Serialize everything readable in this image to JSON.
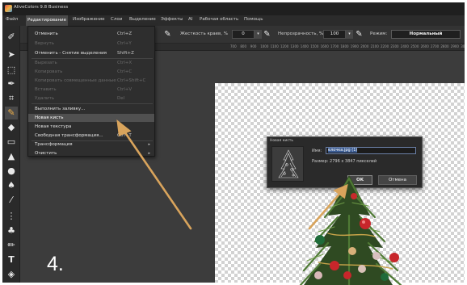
{
  "app": {
    "title": "AliveColors 9.8 Business"
  },
  "menu": {
    "items": [
      "Файл",
      "Редактирование",
      "Изображение",
      "Слои",
      "Выделение",
      "Эффекты",
      "AI",
      "Рабочая область",
      "Помощь"
    ],
    "active_index": 1
  },
  "options": {
    "hardness_label": "Жесткость краев, %",
    "hardness_value": "0",
    "opacity_label": "Непрозрачность, %",
    "opacity_value": "100",
    "mode_label": "Режим:",
    "mode_value": "Нормальный"
  },
  "ruler": {
    "ticks": [
      "700",
      "800",
      "900",
      "1000",
      "1100",
      "1200",
      "1300",
      "1400",
      "1500",
      "1600",
      "1700",
      "1800",
      "1900",
      "2000",
      "2100",
      "2200",
      "2300",
      "2400",
      "2500",
      "2600",
      "2700",
      "2800",
      "2900",
      "3000"
    ]
  },
  "edit_menu": {
    "items": [
      {
        "label": "Отменить",
        "shortcut": "Ctrl+Z",
        "disabled": false
      },
      {
        "label": "Вернуть",
        "shortcut": "Ctrl+Y",
        "disabled": true
      },
      {
        "label": "Отменить - Снятие выделения",
        "shortcut": "Shift+Z",
        "disabled": false
      },
      {
        "label": "Вырезать",
        "shortcut": "Ctrl+X",
        "disabled": true
      },
      {
        "label": "Копировать",
        "shortcut": "Ctrl+C",
        "disabled": true
      },
      {
        "label": "Копировать совмещенные данные",
        "shortcut": "Ctrl+Shift+C",
        "disabled": true
      },
      {
        "label": "Вставить",
        "shortcut": "Ctrl+V",
        "disabled": true
      },
      {
        "label": "Удалить",
        "shortcut": "Del",
        "disabled": true
      },
      {
        "label": "Выполнить заливку...",
        "shortcut": "",
        "disabled": false
      },
      {
        "label": "Новая кисть",
        "shortcut": "",
        "disabled": false,
        "highlighted": true
      },
      {
        "label": "Новая текстура",
        "shortcut": "",
        "disabled": false
      },
      {
        "label": "Свободная трансформация...",
        "shortcut": "Ctrl+T",
        "disabled": false
      },
      {
        "label": "Трансформация",
        "shortcut": "",
        "disabled": false,
        "submenu": true
      },
      {
        "label": "Очистить",
        "shortcut": "",
        "disabled": false,
        "submenu": true
      }
    ]
  },
  "dialog": {
    "title": "Новая кисть",
    "name_label": "Имя:",
    "name_value": "елочка.jpg (1)",
    "size_text": "Размер: 2796 x 3847 пикселей",
    "ok_label": "OK",
    "cancel_label": "Отмена"
  },
  "step": "4.",
  "colors": {
    "arrow": "#d9a45c",
    "accent": "#3b5c93"
  }
}
